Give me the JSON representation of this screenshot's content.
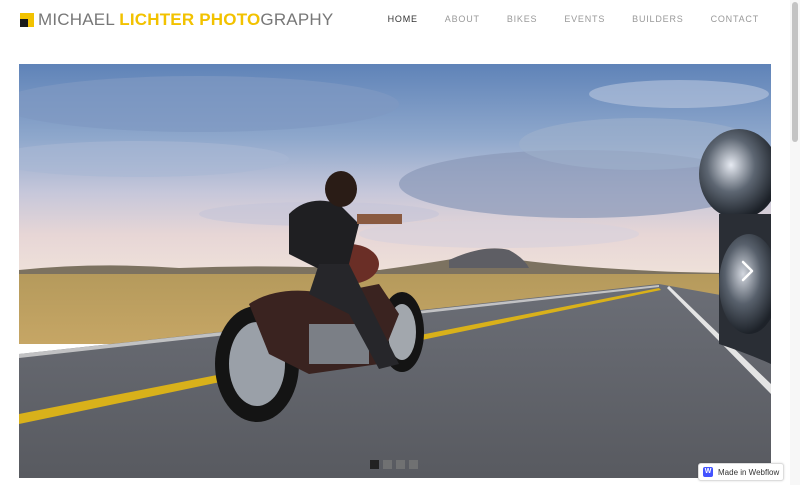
{
  "brand": {
    "name_part1": "MICHAEL ",
    "name_part2": "LICHTER ",
    "name_part3": "PHOTO",
    "name_part4": "GRAPHY",
    "accent_color": "#f2c200",
    "gray_color": "#777777",
    "logo_icon": "logo-square-icon"
  },
  "nav": {
    "items": [
      {
        "label": "HOME",
        "active": true
      },
      {
        "label": "ABOUT",
        "active": false
      },
      {
        "label": "BIKES",
        "active": false
      },
      {
        "label": "EVENTS",
        "active": false
      },
      {
        "label": "BUILDERS",
        "active": false
      },
      {
        "label": "CONTACT",
        "active": false
      }
    ]
  },
  "slider": {
    "slide_count": 4,
    "active_index": 0,
    "next_icon": "chevron-right-icon"
  },
  "badge": {
    "logo_letter": "W",
    "label": "Made in Webflow",
    "logo_color": "#4353ff"
  }
}
